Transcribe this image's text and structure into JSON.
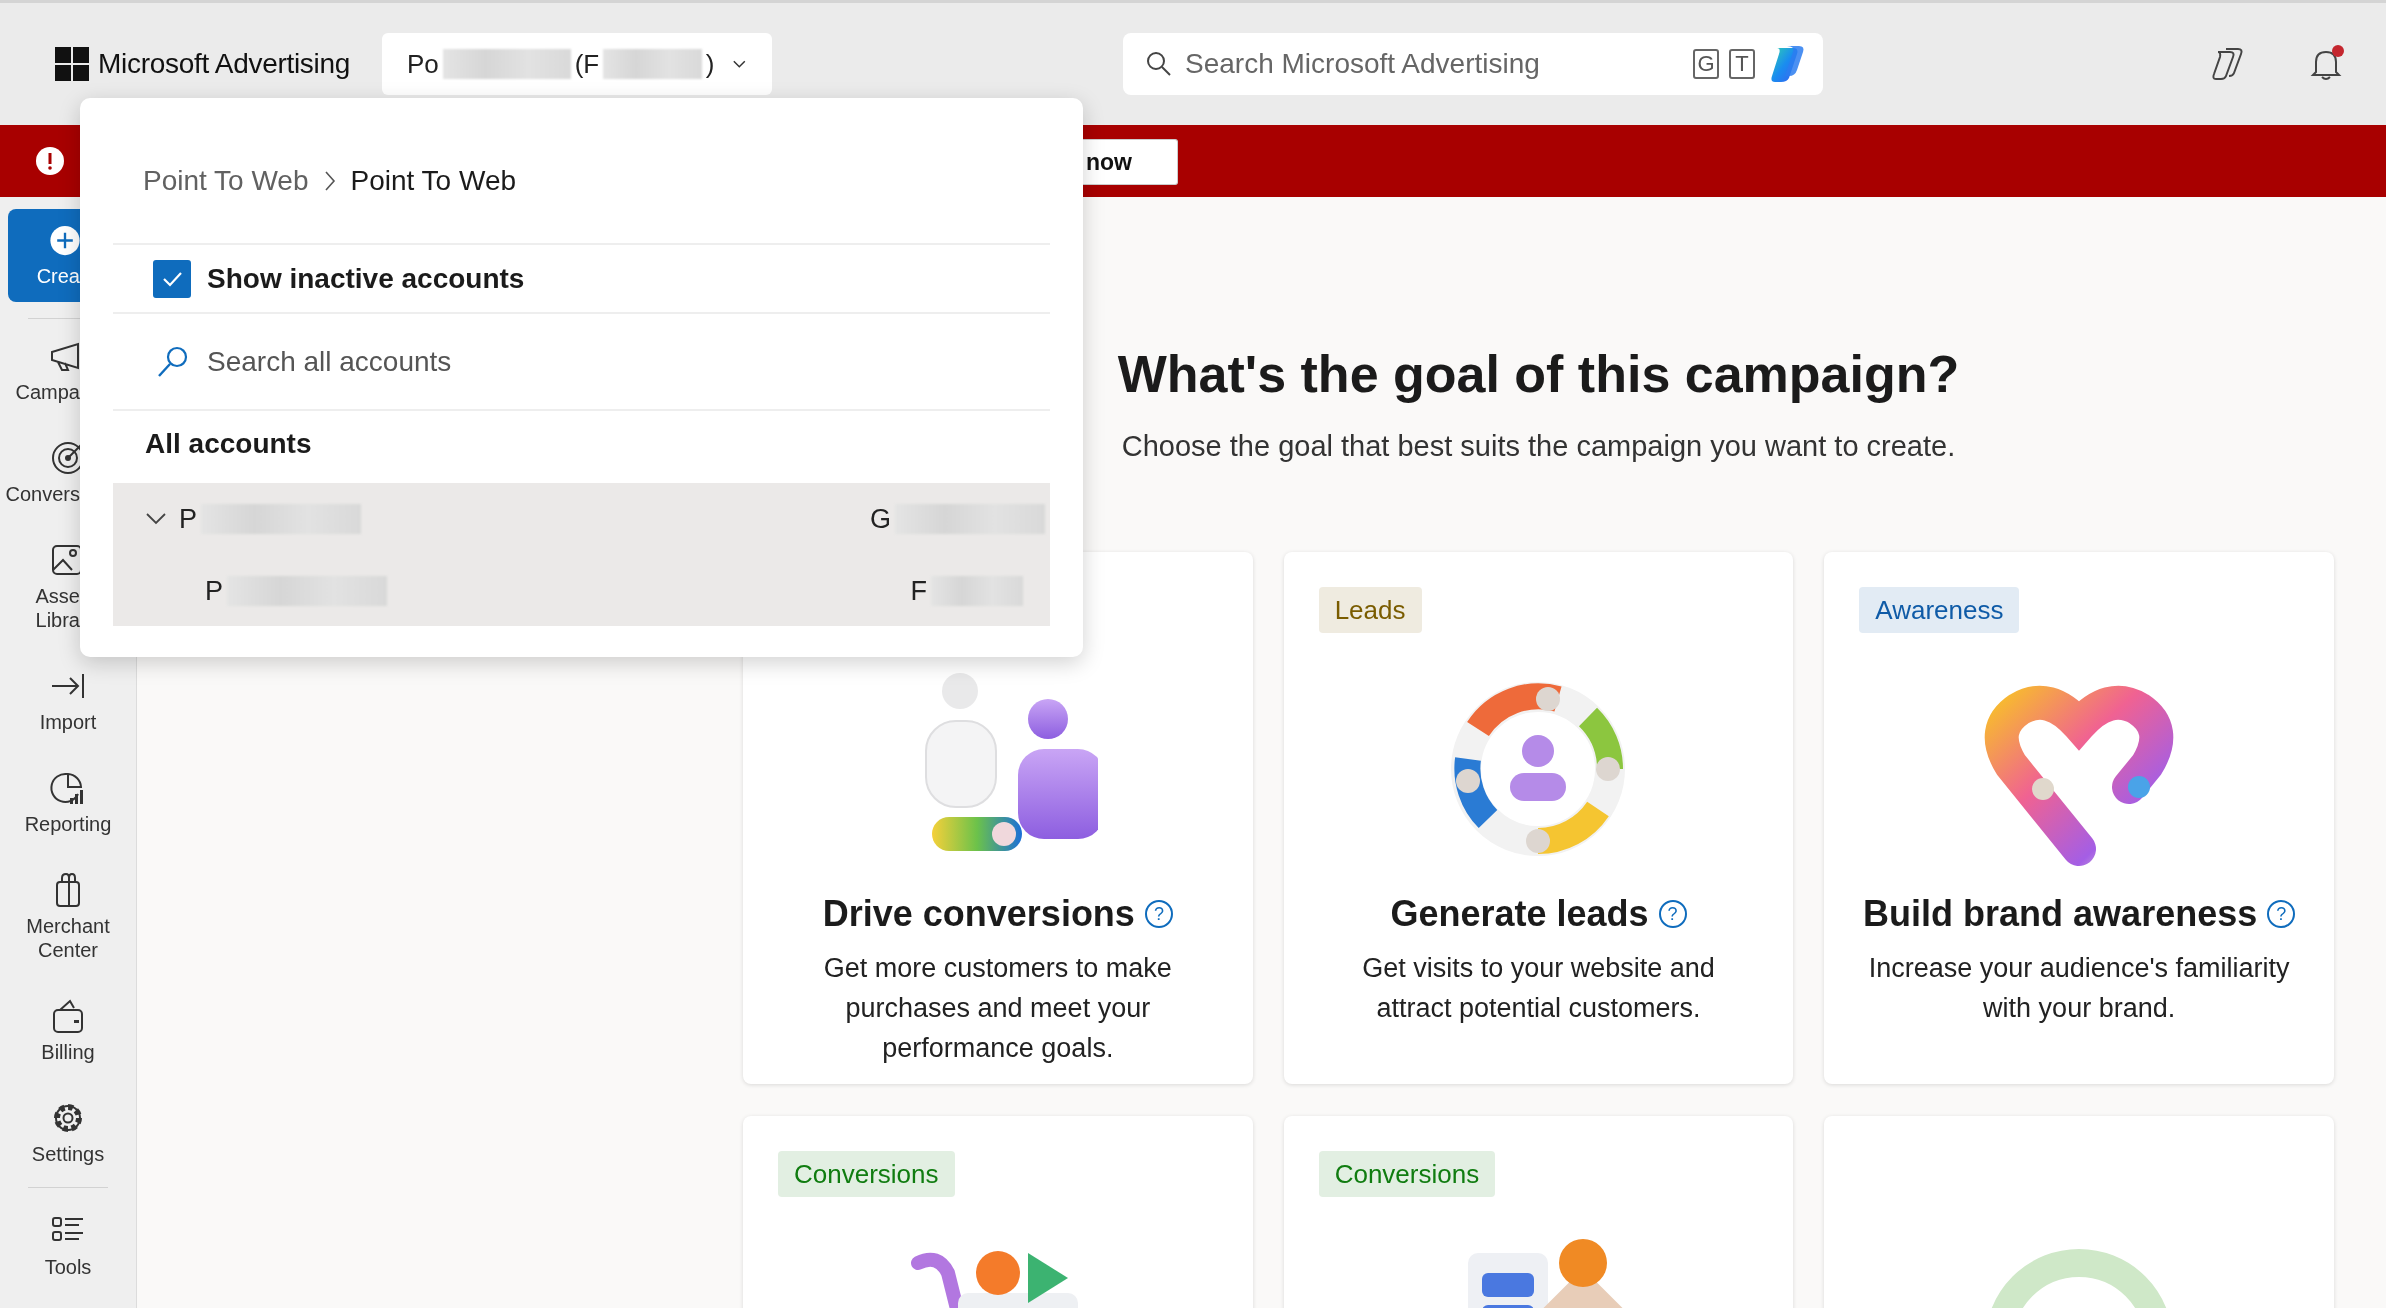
{
  "header": {
    "brand": "Microsoft Advertising",
    "account_selector": {
      "expanded": true,
      "segments": [
        {
          "kind": "text",
          "text": "Po"
        },
        {
          "kind": "redacted"
        },
        {
          "kind": "text",
          "text": "(F"
        },
        {
          "kind": "redacted"
        },
        {
          "kind": "text",
          "text": ")"
        }
      ]
    },
    "search": {
      "placeholder": "Search Microsoft Advertising",
      "shortcut_keys": [
        "G",
        "T"
      ]
    },
    "notifications": {
      "unread": true
    }
  },
  "banner": {
    "button": "now"
  },
  "sidebar": {
    "items": [
      {
        "kind": "create",
        "label": "Crea"
      },
      {
        "kind": "covered",
        "label": "Campa"
      },
      {
        "kind": "covered",
        "label": "Convers"
      },
      {
        "kind": "covered",
        "label": "Asse Libra"
      },
      {
        "kind": "full",
        "label": "Import"
      },
      {
        "kind": "full",
        "label": "Reporting"
      },
      {
        "kind": "full",
        "label": "Merchant Center"
      },
      {
        "kind": "full",
        "label": "Billing"
      },
      {
        "kind": "full",
        "label": "Settings"
      }
    ],
    "bottom_items": [
      {
        "kind": "full",
        "label": "Tools"
      }
    ]
  },
  "account_menu": {
    "breadcrumb": [
      "Point To Web",
      "Point To Web"
    ],
    "show_inactive": {
      "label": "Show inactive accounts",
      "checked": true
    },
    "search": {
      "placeholder": "Search all accounts"
    },
    "section_title": "All accounts",
    "accounts": [
      {
        "expanded": true,
        "name": [
          {
            "kind": "text",
            "text": "P"
          },
          {
            "kind": "redacted"
          }
        ],
        "number": [
          {
            "kind": "text",
            "text": "G"
          },
          {
            "kind": "redacted"
          }
        ],
        "children": [
          {
            "name": [
              {
                "kind": "text",
                "text": "P"
              },
              {
                "kind": "redacted"
              }
            ],
            "number": [
              {
                "kind": "text",
                "text": "F"
              },
              {
                "kind": "redacted"
              }
            ]
          }
        ]
      }
    ]
  },
  "main": {
    "title": "What's the goal of this campaign?",
    "subtitle": "Choose the goal that best suits the campaign you want to create.",
    "cards": [
      {
        "kind": "goal",
        "title": "Drive conversions",
        "help": "?",
        "description_lines": [
          "Get more customers to make",
          "purchases and meet your",
          "performance goals."
        ]
      },
      {
        "kind": "goal",
        "tag": {
          "label": "Leads",
          "color": "#7a5c00"
        },
        "title": "Generate leads",
        "help": "?",
        "description_lines": [
          "Get visits to your website and",
          "attract potential customers."
        ]
      },
      {
        "kind": "goal",
        "tag": {
          "label": "Awareness",
          "color": "#0f5ba7"
        },
        "title": "Build brand awareness",
        "help": "?",
        "description_lines": [
          "Increase your audience's familiarity",
          "with your brand."
        ]
      },
      {
        "kind": "goal",
        "tag": {
          "label": "Conversions",
          "color": "#107c10"
        }
      },
      {
        "kind": "goal",
        "tag": {
          "label": "Conversions",
          "color": "#107c10"
        }
      },
      {
        "kind": "goal"
      }
    ]
  }
}
